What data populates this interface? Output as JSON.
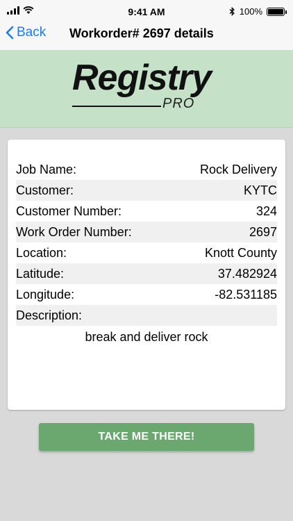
{
  "status_bar": {
    "time": "9:41 AM",
    "battery_text": "100%",
    "battery_level": 1.0,
    "icons": [
      "signal-icon",
      "wifi-icon",
      "bluetooth-icon",
      "battery-icon"
    ]
  },
  "nav": {
    "back_label": "Back",
    "title": "Workorder# 2697 details"
  },
  "logo": {
    "text": "Registry",
    "subtext": "PRO"
  },
  "details": [
    {
      "label": "Job Name:",
      "value": "Rock Delivery"
    },
    {
      "label": "Customer:",
      "value": "KYTC"
    },
    {
      "label": "Customer Number:",
      "value": "324"
    },
    {
      "label": "Work Order Number:",
      "value": "2697"
    },
    {
      "label": "Location:",
      "value": "Knott County"
    },
    {
      "label": "Latitude:",
      "value": "37.482924"
    },
    {
      "label": "Longitude:",
      "value": "-82.531185"
    },
    {
      "label": "Description:",
      "value": ""
    }
  ],
  "description_text": "break and deliver rock",
  "cta_label": "TAKE ME THERE!",
  "colors": {
    "accent": "#1a7cf5",
    "banner": "#c5e2c9",
    "button": "#6aa86f",
    "background": "#d9d9d9"
  }
}
